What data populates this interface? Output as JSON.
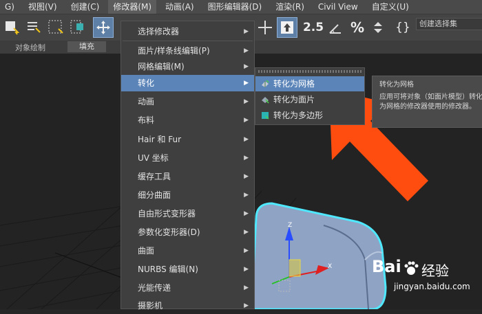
{
  "menubar": {
    "items": [
      "G)",
      "视图(V)",
      "创建(C)",
      "修改器(M)",
      "动画(A)",
      "图形编辑器(D)",
      "渲染(R)",
      "Civil View",
      "自定义(U)"
    ]
  },
  "toolbar": {
    "named_selection_placeholder": "创建选择集",
    "tool_2_5_label": "2.5"
  },
  "subbar": {
    "object_paint": "对象绘制",
    "fill": "填充"
  },
  "dropdown": {
    "items": [
      "选择修改器",
      "面片/样条线编辑(P)",
      "网格编辑(M)",
      "转化",
      "动画",
      "布料",
      "Hair 和 Fur",
      "UV 坐标",
      "缓存工具",
      "细分曲面",
      "自由形式变形器",
      "参数化变形器(D)",
      "曲面",
      "NURBS 编辑(N)",
      "光能传递",
      "摄影机"
    ]
  },
  "submenu": {
    "items": [
      "转化为网格",
      "转化为面片",
      "转化为多边形"
    ]
  },
  "tooltip": {
    "title": "转化为网格",
    "description": "应用可将对象（如面片模型）转化为网格的修改器使用的修改器。"
  },
  "viewport": {
    "gizmo_axis_z": "Z",
    "gizmo_axis_x": "X"
  },
  "watermark": {
    "brand": "Bai",
    "brand_suffix": "经验",
    "url": "jingyan.baidu.com"
  },
  "colors": {
    "highlight": "#5b84b8",
    "arrow": "#ff4d0f",
    "object": "#8fa3c4",
    "object_outline": "#4fe8ff"
  }
}
